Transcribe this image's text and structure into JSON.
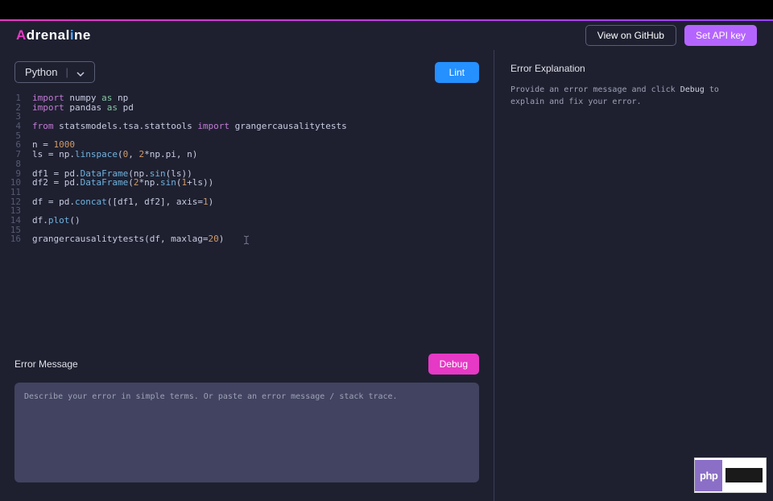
{
  "logo": {
    "char1": "A",
    "mid": "drenal",
    "char2": "i",
    "end": "ne"
  },
  "header": {
    "github_label": "View on GitHub",
    "apikey_label": "Set API key"
  },
  "toolbar": {
    "language": "Python",
    "lint_label": "Lint"
  },
  "code": {
    "lines": [
      "1",
      "2",
      "3",
      "4",
      "5",
      "6",
      "7",
      "8",
      "9",
      "10",
      "11",
      "12",
      "13",
      "14",
      "15",
      "16"
    ]
  },
  "error": {
    "title": "Error Message",
    "debug_label": "Debug",
    "placeholder": "Describe your error in simple terms. Or paste an error message / stack trace."
  },
  "explanation": {
    "title": "Error Explanation",
    "desc_pre": "Provide an error message and click ",
    "desc_hl": "Debug",
    "desc_post": " to explain and fix your error."
  },
  "badge": {
    "php": "php"
  }
}
